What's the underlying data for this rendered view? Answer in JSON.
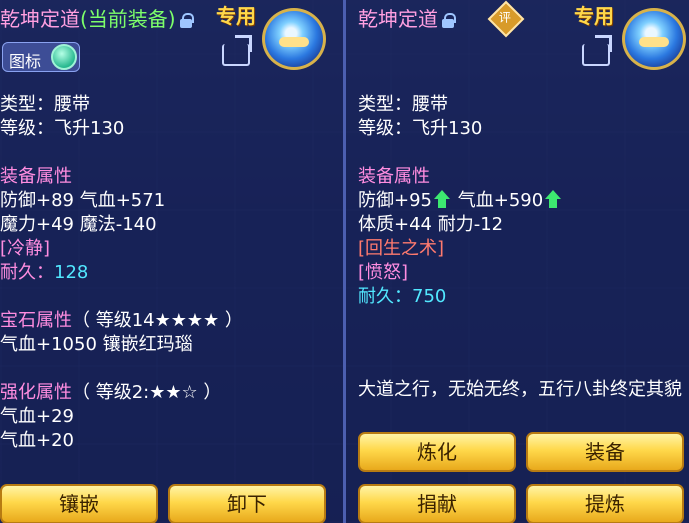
{
  "colors": {
    "title": "#ff9fe0",
    "equipped": "#7dff6a",
    "section": "#ff8de0",
    "durability": "#52e8ff",
    "button": "#ffd84a"
  },
  "left": {
    "title": "乾坤定道",
    "equipped_tag": "(当前装备)",
    "exclusive": "专用",
    "badge_label": "图标",
    "type_line": "类型：腰带",
    "level_line": "等级：飞升130",
    "attr_header": "装备属性",
    "attr_line1": "防御+89 气血+571",
    "attr_line2": "魔力+49 魔法-140",
    "special": "[冷静]",
    "durability_label": "耐久：",
    "durability_value": "128",
    "gem_header": "宝石属性",
    "gem_level": "（ 等级14★★★★ ）",
    "gem_line": "气血+1050 镶嵌红玛瑙",
    "enhance_header": "强化属性",
    "enhance_level": "（ 等级2:★★☆ ）",
    "enhance_line1": "气血+29",
    "enhance_line2": "气血+20",
    "buttons": [
      "镶嵌",
      "卸下"
    ]
  },
  "right": {
    "title": "乾坤定道",
    "rate_icon": "评",
    "exclusive": "专用",
    "type_line": "类型：腰带",
    "level_line": "等级：飞升130",
    "attr_header": "装备属性",
    "attr_defense": "防御+95",
    "attr_hp": "气血+590",
    "attr_line2": "体质+44 耐力-12",
    "special1": "[回生之术]",
    "special2": "[愤怒]",
    "durability_label": "耐久：",
    "durability_value": "750",
    "description": "大道之行，无始无终，五行八卦终定其貌",
    "buttons": [
      "炼化",
      "装备",
      "捐献",
      "提炼"
    ]
  },
  "icons": [
    "lock-icon",
    "share-icon",
    "item-belt-icon",
    "rate-icon",
    "arrow-up-icon",
    "toggle-knob-icon"
  ]
}
